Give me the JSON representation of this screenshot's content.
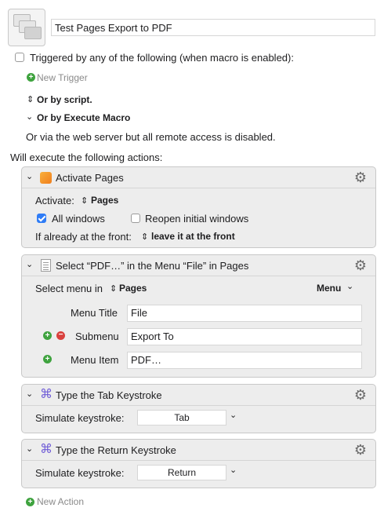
{
  "macro": {
    "title": "Test Pages Export to PDF"
  },
  "triggers": {
    "header": "Triggered by any of the following (when macro is enabled):",
    "new_trigger": "New Trigger",
    "or_script": "Or by script.",
    "or_execute_macro": "Or by Execute Macro",
    "web_server_note": "Or via the web server but all remote access is disabled."
  },
  "actions_header": "Will execute the following actions:",
  "actions": [
    {
      "title": "Activate Pages",
      "activate_label": "Activate:",
      "activate_value": "Pages",
      "all_windows_label": "All windows",
      "all_windows_checked": true,
      "reopen_label": "Reopen initial windows",
      "reopen_checked": false,
      "front_label": "If already at the front:",
      "front_value": "leave it at the front"
    },
    {
      "title": "Select “PDF…” in the Menu “File” in Pages",
      "select_in_label": "Select menu in",
      "select_in_value": "Pages",
      "menu_dropdown": "Menu",
      "menu_title_label": "Menu Title",
      "menu_title_value": "File",
      "submenu_label": "Submenu",
      "submenu_value": "Export To",
      "menu_item_label": "Menu Item",
      "menu_item_value": "PDF…"
    },
    {
      "title": "Type the Tab Keystroke",
      "simulate_label": "Simulate keystroke:",
      "keystroke": "Tab"
    },
    {
      "title": "Type the Return Keystroke",
      "simulate_label": "Simulate keystroke:",
      "keystroke": "Return"
    }
  ],
  "new_action": "New Action",
  "icons": {
    "gear": "gear-icon",
    "pages": "pages-app-icon",
    "menu": "menu-icon",
    "keystroke": "command-key-icon"
  },
  "colors": {
    "accent": "#2f7cf6",
    "add_green": "#3fa33f",
    "remove_red": "#d9413e",
    "command_purple": "#6f5cd6"
  }
}
